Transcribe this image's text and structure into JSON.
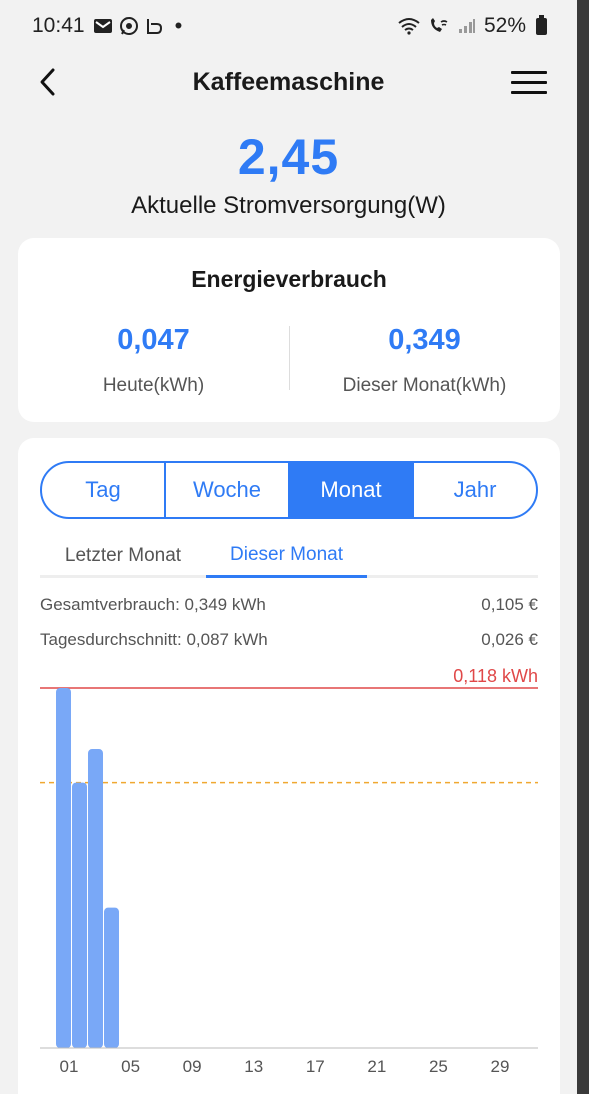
{
  "status_bar": {
    "time": "10:41",
    "battery": "52%",
    "icons": [
      "mail-icon",
      "whatsapp-icon",
      "app-icon",
      "wifi-icon",
      "wifi-call-icon",
      "signal-icon",
      "battery-icon"
    ]
  },
  "header": {
    "title": "Kaffeemaschine",
    "back_icon": "chevron-left-icon",
    "menu_icon": "hamburger-menu-icon"
  },
  "power": {
    "value": "2,45",
    "label": "Aktuelle Stromversorgung(W)"
  },
  "energy": {
    "title": "Energieverbrauch",
    "today_value": "0,047",
    "today_label": "Heute(kWh)",
    "month_value": "0,349",
    "month_label": "Dieser Monat(kWh)"
  },
  "period_tabs": [
    {
      "label": "Tag",
      "active": false
    },
    {
      "label": "Woche",
      "active": false
    },
    {
      "label": "Monat",
      "active": true
    },
    {
      "label": "Jahr",
      "active": false
    }
  ],
  "month_tabs": [
    {
      "label": "Letzter Monat",
      "active": false
    },
    {
      "label": "Dieser Monat",
      "active": true
    }
  ],
  "stats": {
    "total_label": "Gesamtverbrauch: 0,349 kWh",
    "total_cost": "0,105 €",
    "avg_label": "Tagesdurchschnitt: 0,087 kWh",
    "avg_cost": "0,026 €"
  },
  "colors": {
    "accent": "#2f7bf5",
    "bar": "#79a8f7",
    "max_line": "#e04848",
    "avg_line": "#f0a830"
  },
  "chart_data": {
    "type": "bar",
    "x": [
      1,
      2,
      3,
      4
    ],
    "values": [
      0.118,
      0.087,
      0.098,
      0.046
    ],
    "max_label": "0,118 kWh",
    "max_value": 0.118,
    "average_value": 0.087,
    "x_range": [
      1,
      31
    ],
    "ylim": [
      0,
      0.118
    ],
    "tick_labels": [
      "01",
      "05",
      "09",
      "13",
      "17",
      "21",
      "25",
      "29"
    ],
    "tick_values": [
      1,
      5,
      9,
      13,
      17,
      21,
      25,
      29
    ]
  }
}
